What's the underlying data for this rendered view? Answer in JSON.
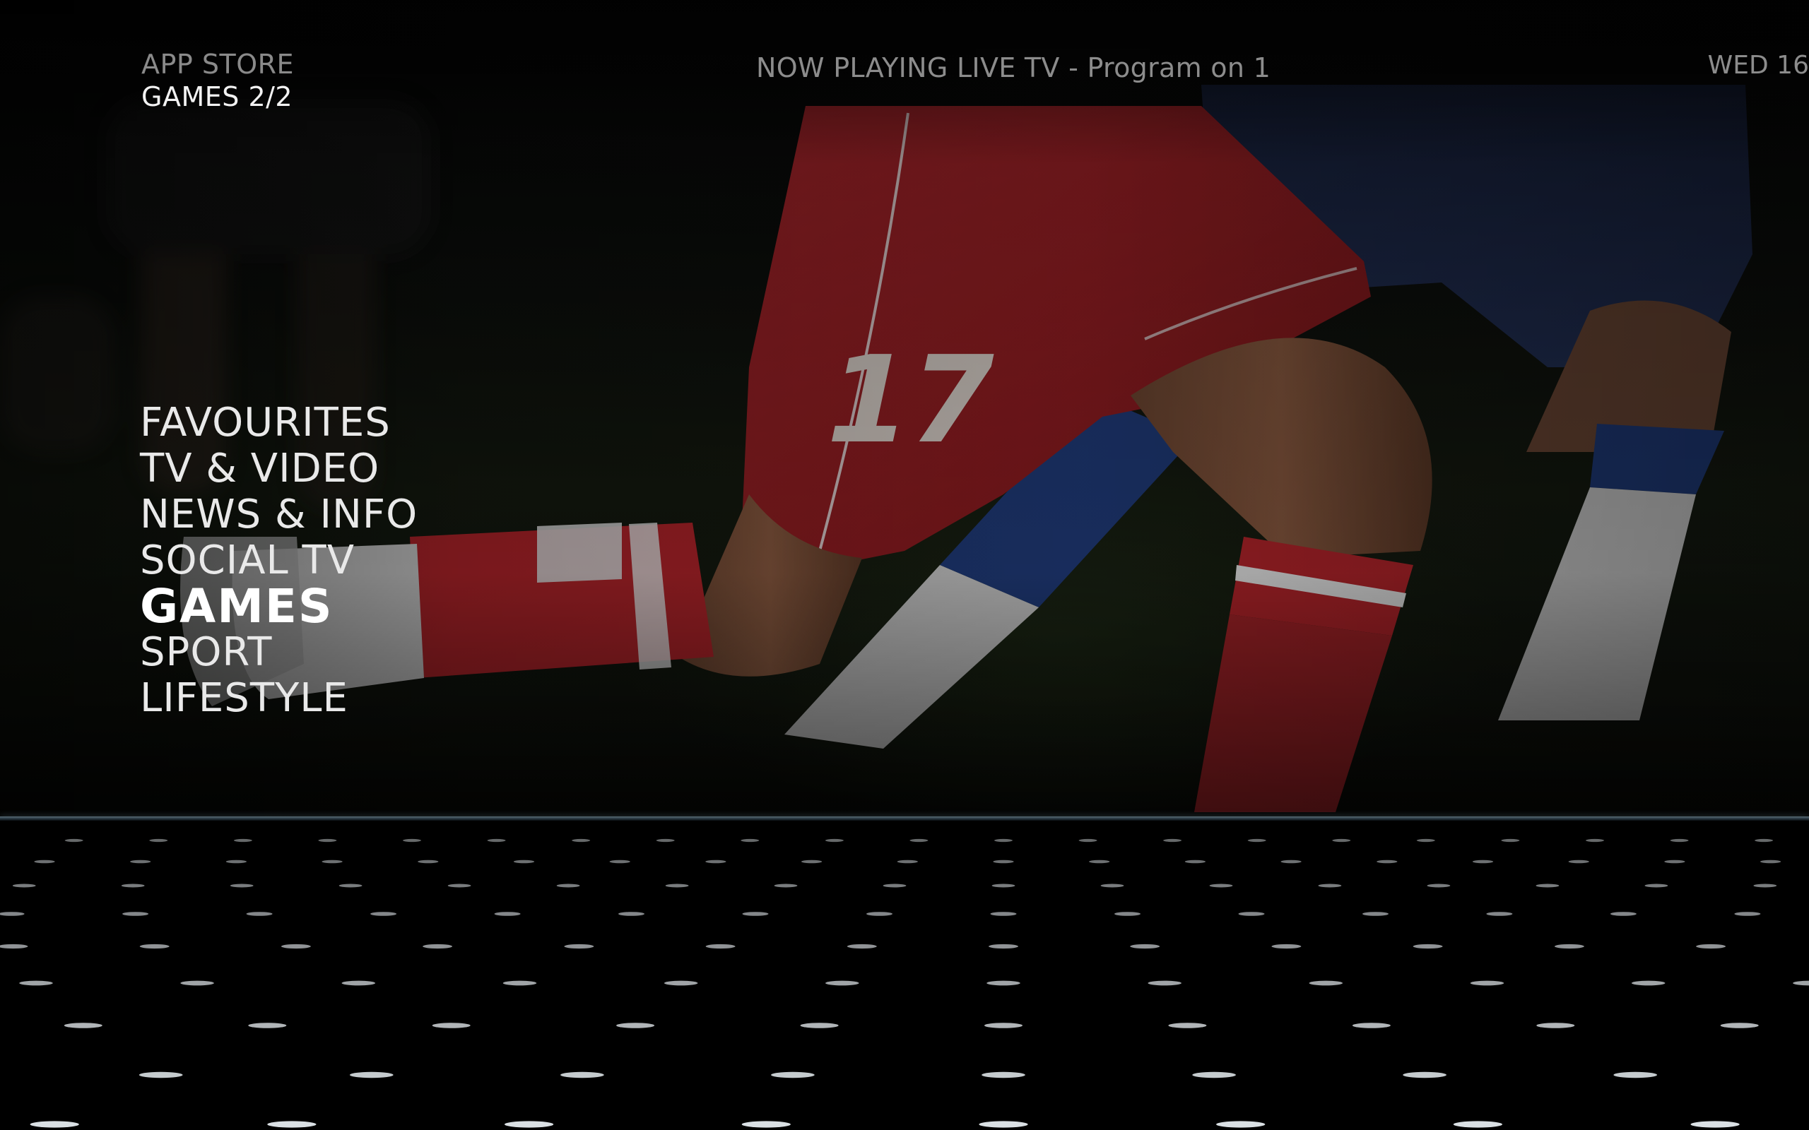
{
  "header": {
    "section": "APP STORE",
    "page": "GAMES 2/2",
    "now_playing": "NOW PLAYING LIVE TV - Program on 1",
    "date": "WED 16"
  },
  "menu": {
    "items": [
      {
        "label": "FAVOURITES",
        "active": false
      },
      {
        "label": "TV & VIDEO",
        "active": false
      },
      {
        "label": "NEWS & INFO",
        "active": false
      },
      {
        "label": "SOCIAL TV",
        "active": false
      },
      {
        "label": "GAMES",
        "active": true
      },
      {
        "label": "SPORT",
        "active": false
      },
      {
        "label": "LIFESTYLE",
        "active": false
      }
    ]
  },
  "background": {
    "scene": "soccer-players-legs",
    "jersey_number": "17",
    "colors": {
      "shorts_red": "#b3242a",
      "shorts_navy": "#1c2a55",
      "grass": "#1e2a14",
      "divider": "#4a5d68"
    }
  }
}
